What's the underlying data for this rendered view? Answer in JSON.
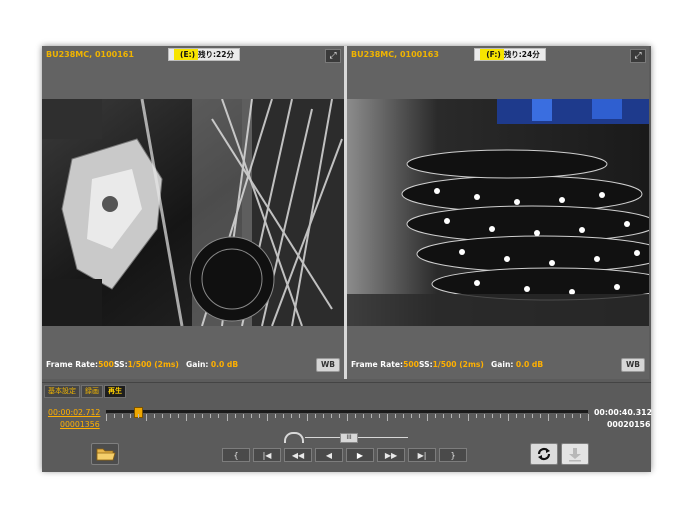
{
  "panes": [
    {
      "camera": "BU238MC, 0100161",
      "storage": {
        "drive": "(E:)",
        "remaining": "残り:22分"
      },
      "frame_rate_label": "Frame Rate:",
      "frame_rate": "500",
      "ss_label": "SS:",
      "ss": "1/500 (2ms)",
      "gain_label": "Gain:",
      "gain": "0.0 dB",
      "wb_label": "WB"
    },
    {
      "camera": "BU238MC, 0100163",
      "storage": {
        "drive": "(F:)",
        "remaining": "残り:24分"
      },
      "frame_rate_label": "Frame Rate:",
      "frame_rate": "500",
      "ss_label": "SS:",
      "ss": "1/500 (2ms)",
      "gain_label": "Gain:",
      "gain": "0.0 dB",
      "wb_label": "WB"
    }
  ],
  "tabs": [
    "基本設定",
    "録画",
    "再生"
  ],
  "active_tab": "再生",
  "playback": {
    "current_time": "00:00:02.712",
    "current_frame": "00001356",
    "total_time": "00:00:40.312",
    "total_frame": "00020156",
    "position": 0.067,
    "speed_thumb_label": "III"
  },
  "controls": [
    {
      "name": "mark-in-button",
      "glyph": "{"
    },
    {
      "name": "go-to-start-button",
      "glyph": "|◀"
    },
    {
      "name": "fast-reverse-button",
      "glyph": "◀◀"
    },
    {
      "name": "reverse-play-button",
      "glyph": "◀"
    },
    {
      "name": "play-button",
      "glyph": "▶"
    },
    {
      "name": "fast-forward-button",
      "glyph": "▶▶"
    },
    {
      "name": "go-to-end-button",
      "glyph": "▶|"
    },
    {
      "name": "mark-out-button",
      "glyph": "}"
    }
  ],
  "colors": {
    "accent": "#ffb000",
    "panel": "#5c5c5c",
    "highlight": "#f7e400"
  },
  "icons": [
    "expand-icon",
    "folder-icon",
    "sync-icon",
    "download-icon",
    "speed-dial-icon"
  ]
}
